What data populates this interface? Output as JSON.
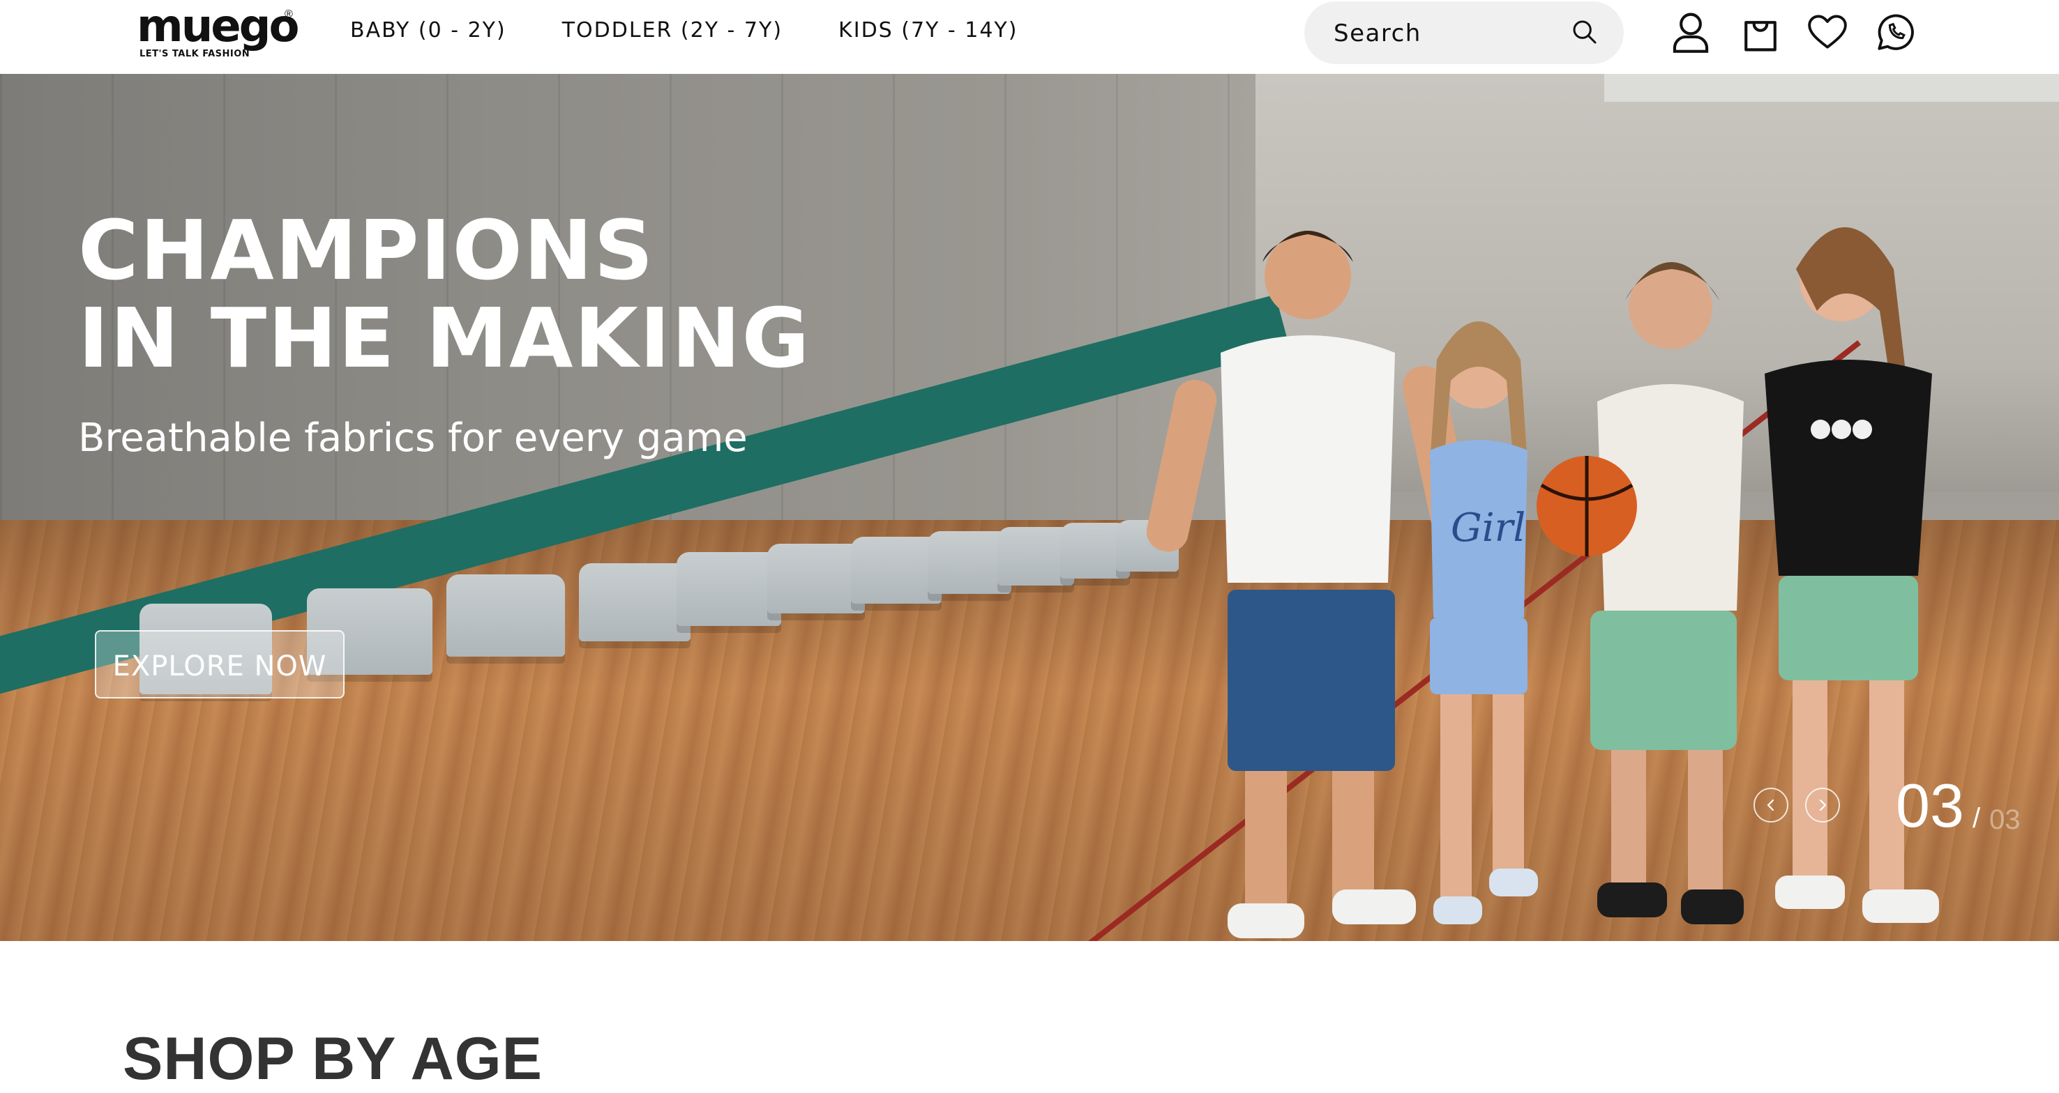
{
  "brand": {
    "logo_text": "muego",
    "registered": "®",
    "tagline": "LET'S TALK FASHION"
  },
  "nav": {
    "items": [
      {
        "label": "BABY (0 - 2Y)"
      },
      {
        "label": "TODDLER (2Y - 7Y)"
      },
      {
        "label": "KIDS (7Y - 14Y)"
      }
    ]
  },
  "search": {
    "placeholder": "Search"
  },
  "header_icons": [
    "account-icon",
    "cart-icon",
    "wishlist-icon",
    "whatsapp-icon"
  ],
  "hero": {
    "title_line1": "CHAMPIONS",
    "title_line2": "IN THE MAKING",
    "subtitle": "Breathable fabrics for every game",
    "cta_label": "EXPLORE NOW",
    "slide_current": "03",
    "slide_separator": "/",
    "slide_total": "03"
  },
  "sections": {
    "shop_by_age_title": "SHOP BY AGE"
  }
}
